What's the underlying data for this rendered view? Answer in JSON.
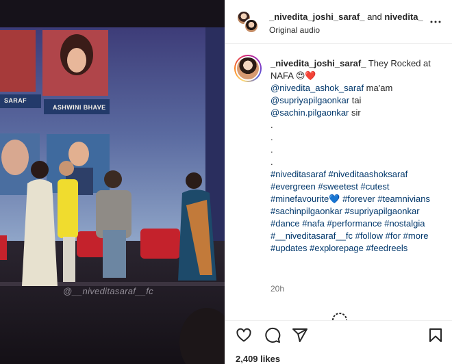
{
  "post": {
    "header_user_1": "_nivedita_joshi_saraf_",
    "header_connector": " and ",
    "header_user_2": "nivedita_",
    "audio": "Original audio",
    "caption_username": "_nivedita_joshi_saraf_",
    "caption_intro": "They Rocked at NAFA 😍❤️",
    "mentions": [
      {
        "handle": "@nivedita_ashok_saraf",
        "suffix": " ma'am"
      },
      {
        "handle": "@supriyapilgaonkar",
        "suffix": " tai"
      },
      {
        "handle": "@sachin.pilgaonkar",
        "suffix": " sir"
      }
    ],
    "dots": [
      ".",
      ".",
      ".",
      "."
    ],
    "hashtags": "#niveditasaraf #niveditaashoksaraf #evergreen #sweetest #cutest #minefavourite💙 #forever #teamnivians #sachinpilgaonkar #supriyapilgaonkar #dance #nafa #performance #nostalgia #__niveditasaraf__fc #follow #for #more #updates #explorepage #feedreels",
    "time": "20h",
    "likes": "2,409 likes"
  },
  "media": {
    "watermark": "@__niveditasaraf__fc",
    "screen_names": [
      "SARAF",
      "ASHWINI BHAVE"
    ]
  },
  "icons": {
    "more": "more-horizontal-icon",
    "like": "heart-icon",
    "comment": "comment-icon",
    "share": "share-icon",
    "save": "bookmark-icon"
  },
  "colors": {
    "text": "#262626",
    "link": "#00376b",
    "muted": "#737373",
    "heart": "#ed4956"
  }
}
